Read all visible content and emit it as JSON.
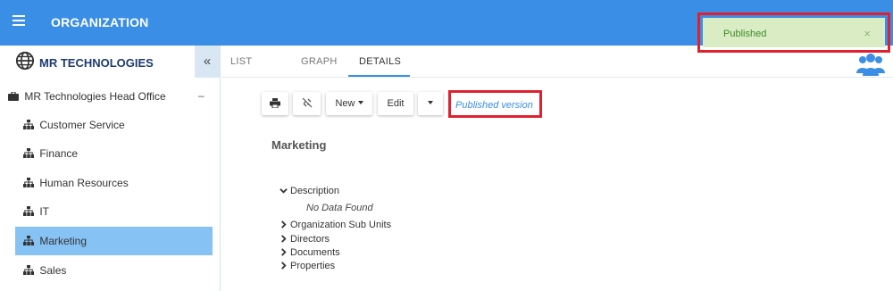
{
  "header": {
    "title": "ORGANIZATION",
    "menu_icon": "hamburger-icon",
    "bg_color": "#3a8ee6"
  },
  "toast": {
    "message": "Published",
    "close_label": "×",
    "bg_color": "#d9ecc4"
  },
  "sidebar": {
    "company": "MR TECHNOLOGIES",
    "collapse_label": "«",
    "root": {
      "label": "MR Technologies Head Office",
      "toggle": "–"
    },
    "items": [
      {
        "label": "Customer Service",
        "active": false
      },
      {
        "label": "Finance",
        "active": false
      },
      {
        "label": "Human Resources",
        "active": false
      },
      {
        "label": "IT",
        "active": false
      },
      {
        "label": "Marketing",
        "active": true
      },
      {
        "label": "Sales",
        "active": false
      }
    ],
    "active_color": "#87c2f5"
  },
  "main": {
    "tabs": [
      {
        "label": "LIST",
        "active": false
      },
      {
        "label": "GRAPH",
        "active": false
      },
      {
        "label": "DETAILS",
        "active": true
      }
    ],
    "toolbar": {
      "print_icon": "print-icon",
      "unlink_icon": "unlink-icon",
      "new_label": "New",
      "edit_label": "Edit",
      "published_version": "Published version"
    },
    "section_title": "Marketing",
    "details": [
      {
        "label": "Description",
        "expanded": true,
        "empty_text": "No Data Found"
      },
      {
        "label": "Organization Sub Units",
        "expanded": false
      },
      {
        "label": "Directors",
        "expanded": false
      },
      {
        "label": "Documents",
        "expanded": false
      },
      {
        "label": "Properties",
        "expanded": false
      }
    ]
  }
}
